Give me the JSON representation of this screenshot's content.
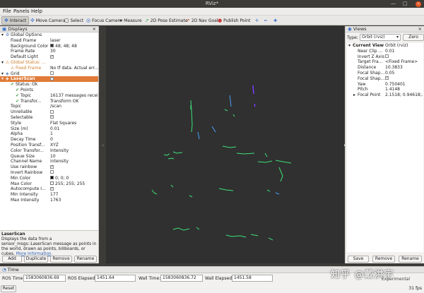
{
  "window": {
    "title": "RViz*"
  },
  "menu": {
    "file": "File",
    "panels": "Panels",
    "help": "Help"
  },
  "toolbar": {
    "interact": "Interact",
    "move_camera": "Move Camera",
    "select": "Select",
    "focus_camera": "Focus Camera",
    "measure": "Measure",
    "pose_estimate": "2D Pose Estimate",
    "nav_goal": "2D Nav Goal",
    "publish_point": "Publish Point"
  },
  "displays": {
    "title": "Displays",
    "rows": [
      {
        "key": "Global Options",
        "value": "",
        "indent": 1,
        "icon": "gear"
      },
      {
        "key": "Fixed Frame",
        "value": "laser",
        "indent": 2
      },
      {
        "key": "Background Color",
        "value": "48; 48; 48",
        "indent": 2,
        "swatch": "#303030"
      },
      {
        "key": "Frame Rate",
        "value": "30",
        "indent": 2
      },
      {
        "key": "Default Light",
        "value": "",
        "indent": 2,
        "check": true
      },
      {
        "key": "Global Status: ...",
        "value": "",
        "indent": 1,
        "icon": "warn"
      },
      {
        "key": "Fixed Frame",
        "value": "No tf data.  Actual err...",
        "indent": 2,
        "icon": "warn"
      },
      {
        "key": "Grid",
        "value": "",
        "indent": 1,
        "icon": "grid",
        "check": false
      },
      {
        "key": "LaserScan",
        "value": "",
        "indent": 1,
        "icon": "laser",
        "check": true,
        "selected": true
      },
      {
        "key": "Status: Ok",
        "value": "",
        "indent": 2,
        "icon": "ok"
      },
      {
        "key": "Points",
        "value": "",
        "indent": 3,
        "icon": "ok"
      },
      {
        "key": "Topic",
        "value": "16137 messages recei...",
        "indent": 3,
        "icon": "ok"
      },
      {
        "key": "Transfor...",
        "value": "Transform OK",
        "indent": 3,
        "icon": "ok"
      },
      {
        "key": "Topic",
        "value": "/scan",
        "indent": 2
      },
      {
        "key": "Unreliable",
        "value": "",
        "indent": 2,
        "check": false
      },
      {
        "key": "Selectable",
        "value": "",
        "indent": 2,
        "check": true
      },
      {
        "key": "Style",
        "value": "Flat Squares",
        "indent": 2
      },
      {
        "key": "Size (m)",
        "value": "0.01",
        "indent": 2
      },
      {
        "key": "Alpha",
        "value": "1",
        "indent": 2
      },
      {
        "key": "Decay Time",
        "value": "0",
        "indent": 2
      },
      {
        "key": "Position Transf...",
        "value": "XYZ",
        "indent": 2
      },
      {
        "key": "Color Transfor...",
        "value": "Intensity",
        "indent": 2
      },
      {
        "key": "Queue Size",
        "value": "10",
        "indent": 2
      },
      {
        "key": "Channel Name",
        "value": "intensity",
        "indent": 2
      },
      {
        "key": "Use rainbow",
        "value": "",
        "indent": 2,
        "check": true
      },
      {
        "key": "Invert Rainbow",
        "value": "",
        "indent": 2,
        "check": false
      },
      {
        "key": "Min Color",
        "value": "0; 0; 0",
        "indent": 2,
        "swatch": "#000000"
      },
      {
        "key": "Max Color",
        "value": "255; 255; 255",
        "indent": 2,
        "swatch": "#ffffff"
      },
      {
        "key": "Autocompute I...",
        "value": "",
        "indent": 2,
        "check": true
      },
      {
        "key": "Min Intensity",
        "value": "177",
        "indent": 2
      },
      {
        "key": "Max Intensity",
        "value": "1763",
        "indent": 2
      }
    ],
    "description_title": "LaserScan",
    "description_text": "Displays the data from a sensor_msgs::LaserScan message as points in the world, drawn as points, billboards, or cubes.",
    "description_link": "More Information.",
    "buttons": {
      "add": "Add",
      "duplicate": "Duplicate",
      "remove": "Remove",
      "rename": "Rename"
    }
  },
  "views": {
    "title": "Views",
    "type_label": "Type:",
    "type_value": "Orbit (rviz)",
    "zero": "Zero",
    "rows": [
      {
        "key": "Current View",
        "value": "Orbit (rviz)",
        "indent": 1,
        "bold": true
      },
      {
        "key": "Near Clip ...",
        "value": "0.01",
        "indent": 2
      },
      {
        "key": "Invert Z Axis",
        "value": "",
        "indent": 2,
        "check": false
      },
      {
        "key": "Target Fra...",
        "value": "<Fixed Frame>",
        "indent": 2
      },
      {
        "key": "Distance",
        "value": "10.3833",
        "indent": 2
      },
      {
        "key": "Focal Shap...",
        "value": "0.05",
        "indent": 2
      },
      {
        "key": "Focal Shap...",
        "value": "",
        "indent": 2,
        "check": true
      },
      {
        "key": "Yaw",
        "value": "0.750401",
        "indent": 2
      },
      {
        "key": "Pitch",
        "value": "1.4148",
        "indent": 2
      },
      {
        "key": "Focal Point",
        "value": "2.1518; 0.94618;...",
        "indent": 2,
        "expander": true
      }
    ],
    "buttons": {
      "save": "Save",
      "remove": "Remove",
      "rename": "Rename"
    }
  },
  "time": {
    "title": "Time",
    "ros_time_label": "ROS Time:",
    "ros_time": "1583060836.69",
    "ros_elapsed_label": "ROS Elapsed:",
    "ros_elapsed": "1451.64",
    "wall_time_label": "Wall Time:",
    "wall_time": "1583060836.72",
    "wall_elapsed_label": "Wall Elapsed:",
    "wall_elapsed": "1451.58",
    "reset": "Reset",
    "fps": "31 fps",
    "experimental": "Experimental"
  },
  "watermark": "知乎 @戴洪宇",
  "colors": {
    "viewport_bg": "#303030",
    "selection": "#e07b39",
    "scan_green": "#3de07a",
    "scan_blue": "#4aa0ff",
    "scan_purple": "#7a3cff"
  }
}
